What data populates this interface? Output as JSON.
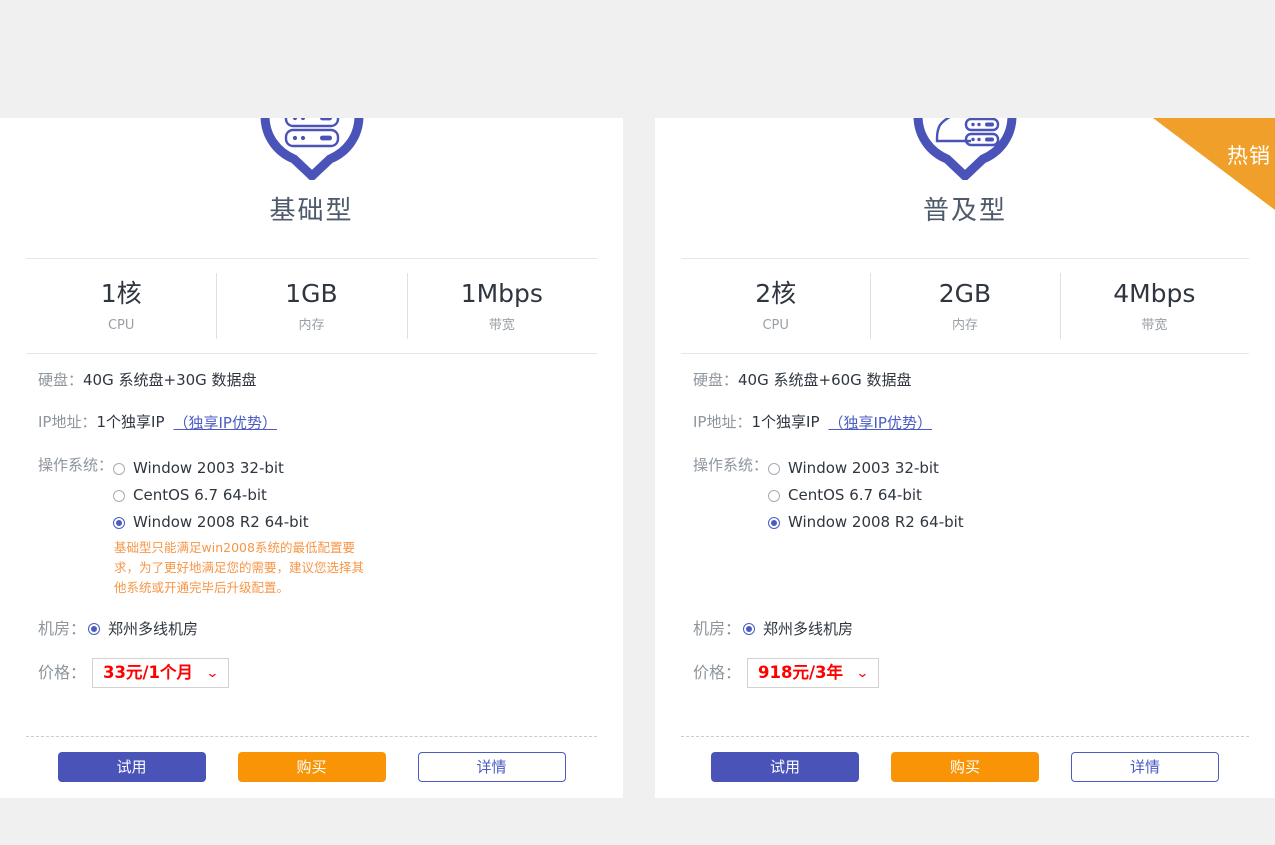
{
  "page": {
    "background": "#f0f0f0",
    "accent_blue": "#4a53b8",
    "accent_orange": "#f89406",
    "price_red": "#ff0000",
    "warn_orange": "#f79646"
  },
  "common": {
    "labels": {
      "disk": "硬盘：",
      "ip": "IP地址：",
      "os": "操作系统：",
      "datacenter": "机房：",
      "price": "价格："
    },
    "ip_value": "1个独享IP",
    "ip_link": "（独享IP优势）",
    "datacenter_value": "郑州多线机房",
    "os_options": [
      {
        "label": "Window 2003 32-bit",
        "selected": false
      },
      {
        "label": "CentOS 6.7 64-bit",
        "selected": false
      },
      {
        "label": "Window 2008 R2 64-bit",
        "selected": true
      }
    ],
    "buttons": {
      "trial": "试用",
      "buy": "购买",
      "detail": "详情"
    },
    "spec_labels": {
      "cpu": "CPU",
      "memory": "内存",
      "bandwidth": "带宽"
    },
    "caret_glyph": "⌄"
  },
  "cards": [
    {
      "id": "basic",
      "title": "基础型",
      "icon": "server-rack-pin-icon",
      "badge": null,
      "specs": {
        "cpu": "1核",
        "memory": "1GB",
        "bandwidth": "1Mbps"
      },
      "disk": "40G 系统盘+30G 数据盘",
      "warning": "基础型只能满足win2008系统的最低配置要求，为了更好地满足您的需要，建议您选择其他系统或开通完毕后升级配置。",
      "price": "33元/1个月"
    },
    {
      "id": "popular",
      "title": "普及型",
      "icon": "user-server-pin-icon",
      "badge": "热销",
      "specs": {
        "cpu": "2核",
        "memory": "2GB",
        "bandwidth": "4Mbps"
      },
      "disk": "40G 系统盘+60G 数据盘",
      "warning": null,
      "price": "918元/3年"
    }
  ]
}
